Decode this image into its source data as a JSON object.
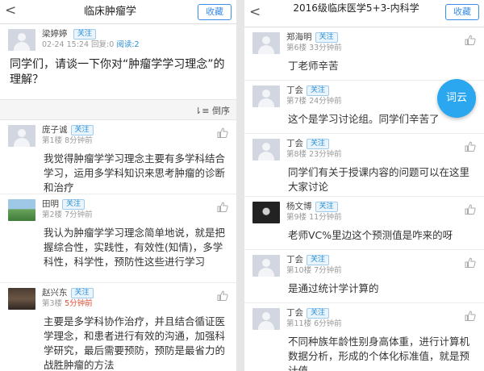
{
  "left": {
    "header": {
      "back_glyph": "<",
      "title": "临床肿瘤学",
      "fav_label": "收藏"
    },
    "post": {
      "author": "梁婷婷",
      "follow": "关注",
      "datetime": "02-24 15:24",
      "reply": "回复:0",
      "reads": "阅读:2",
      "text": "同学们，请谈一下你对“肿瘤学学习理念”的理解？"
    },
    "sort_label": "⇂≡ 倒序",
    "comments": [
      {
        "name": "庞子诚",
        "follow": "关注",
        "floor": "第1楼",
        "time": "8分钟前",
        "new": false,
        "text": "我觉得肿瘤学学习理念主要有多学科结合学习，运用多学科知识来思考肿瘤的诊断和治疗"
      },
      {
        "name": "田明",
        "follow": "关注",
        "floor": "第2楼",
        "time": "7分钟前",
        "new": false,
        "text": "我认为肿瘤学学习理念简单地说，就是把握综合性，实践性，有效性(知情)，多学科性，科学性，预防性这些进行学习"
      },
      {
        "name": "赵兴东",
        "follow": "关注",
        "floor": "第3楼",
        "time": "5分钟前",
        "new": true,
        "text": "主要是多学科协作治疗，并且结合循证医学理念，和患者进行有效的沟通，加强科学研究，最后需要预防，预防是最省力的战胜肿瘤的方法"
      }
    ]
  },
  "right": {
    "header": {
      "back_glyph": "<",
      "title": "2016级临床医学5+3-内科学",
      "fav_label": "收藏"
    },
    "ciyun_label": "词云",
    "comments": [
      {
        "name": "郑海明",
        "follow": "关注",
        "floor": "第6楼",
        "time": "33分钟前",
        "text": "丁老师辛苦"
      },
      {
        "name": "丁会",
        "follow": "关注",
        "floor": "第7楼",
        "time": "24分钟前",
        "text": "这个是学习讨论组。同学们辛苦了"
      },
      {
        "name": "丁会",
        "follow": "关注",
        "floor": "第8楼",
        "time": "23分钟前",
        "text": "同学们有关于授课内容的问题可以在这里大家讨论"
      },
      {
        "name": "杨文博",
        "follow": "关注",
        "floor": "第9楼",
        "time": "11分钟前",
        "text": "老师VC%里边这个预测值是咋来的呀"
      },
      {
        "name": "丁会",
        "follow": "关注",
        "floor": "第10楼",
        "time": "7分钟前",
        "text": "是通过统计学计算的"
      },
      {
        "name": "丁会",
        "follow": "关注",
        "floor": "第11楼",
        "time": "6分钟前",
        "text": "不同种族年龄性别身高体重，进行计算机数据分析，形成的个体化标准值，就是预计值"
      }
    ]
  },
  "colors": {
    "accent": "#3a8ee6",
    "badge": "#2a8fd6",
    "new_time": "#e04b36",
    "ciyun": "#2aa7ee"
  },
  "icons": {
    "back": "chevron-left-icon",
    "like": "thumbs-up-icon",
    "sort": "sort-icon"
  }
}
